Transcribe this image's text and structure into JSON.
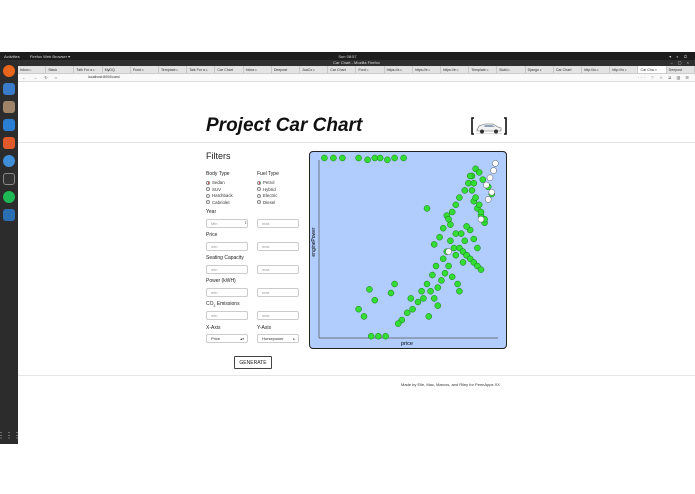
{
  "system": {
    "activities": "Activities",
    "app_menu": "Firefox Web Browser ▾",
    "clock": "Sun 08:57",
    "window_title": "Car Chart - Mozilla Firefox"
  },
  "browser": {
    "tabs": [
      "Inbox ▹",
      "Slack",
      "Talk For a ▹",
      "MyDQ",
      "Front ▹",
      "Template ▹",
      "Talk For a ▹",
      "Car Chart",
      "Inbox ▹",
      "Deepost",
      "JcaCo ▹",
      "Car Chart",
      "Ford ▹",
      "https://a ▹",
      "https://e ▹",
      "https://e ▹",
      "Template ▹",
      "Build ▹",
      "Django ▹",
      "Car Chart",
      "http://lo ▹",
      "http://lo ▹",
      "Car Cha ×",
      "Deepost"
    ],
    "active_tab_index": 22,
    "url": "localhost:8000/cars/",
    "url_menu": "··· ♡ ☆"
  },
  "page": {
    "title": "Project Car Chart",
    "filters_title": "Filters",
    "body_type": {
      "label": "Body Type",
      "options": [
        "Sedan",
        "SUV",
        "Hatchback",
        "Cabriolet"
      ],
      "selected": 0
    },
    "fuel_type": {
      "label": "Fuel Type",
      "options": [
        "Petrol",
        "Hybrid",
        "Electric",
        "Diesel"
      ],
      "selected": 0
    },
    "year": {
      "label": "Year",
      "min_placeholder": "Min",
      "max_placeholder": "max"
    },
    "price": {
      "label": "Price",
      "min_placeholder": "min",
      "max_placeholder": "max"
    },
    "seating": {
      "label": "Seating Capacity",
      "min_placeholder": "min",
      "max_placeholder": "max"
    },
    "power": {
      "label": "Power (kWH)",
      "min_placeholder": "min",
      "max_placeholder": "max"
    },
    "co2": {
      "label_pre": "CO",
      "label_sub": "2",
      "label_post": " Emissions",
      "min_placeholder": "min",
      "max_placeholder": "max"
    },
    "x_axis": {
      "label": "X-Axis",
      "value": "Price"
    },
    "y_axis": {
      "label": "Y-Axis",
      "value": "Horsepower"
    },
    "generate_label": "GENERATE",
    "footer": "Made by Elle, Mac, Marcos, and Riley for PennApps XX"
  },
  "chart_data": {
    "type": "scatter",
    "xlabel": "price",
    "ylabel": "enginePower",
    "colors": {
      "background": "#b0cdfd",
      "point": "#33dd33",
      "point_stroke": "#117711",
      "highlight": "#ffffff"
    },
    "series": [
      {
        "x": [
          0.03,
          0.08,
          0.13,
          0.22,
          0.27,
          0.31,
          0.34,
          0.38,
          0.42,
          0.47,
          0.29,
          0.33,
          0.37,
          0.6,
          0.71,
          0.73,
          0.76,
          0.64,
          0.67,
          0.69,
          0.72,
          0.74,
          0.76,
          0.78,
          0.81,
          0.83,
          0.85,
          0.87,
          0.89,
          0.91,
          0.94,
          0.96,
          0.86,
          0.88,
          0.9,
          0.92,
          0.84,
          0.86,
          0.88,
          0.82,
          0.8,
          0.85,
          0.87,
          0.89,
          0.9,
          0.92,
          0.86,
          0.84,
          0.82,
          0.79,
          0.81,
          0.78,
          0.8,
          0.82,
          0.84,
          0.86,
          0.88,
          0.9,
          0.76,
          0.75,
          0.73,
          0.71,
          0.69,
          0.72,
          0.7,
          0.68,
          0.66,
          0.74,
          0.77,
          0.78,
          0.64,
          0.62,
          0.6,
          0.63,
          0.65,
          0.61,
          0.66,
          0.58,
          0.57,
          0.55,
          0.52,
          0.51,
          0.49,
          0.46,
          0.44,
          0.42,
          0.4,
          0.22,
          0.25,
          0.28,
          0.31
        ],
        "y": [
          1.0,
          1.0,
          1.0,
          1.0,
          0.99,
          1.0,
          1.0,
          0.99,
          1.0,
          1.0,
          0.01,
          0.01,
          0.01,
          0.72,
          0.68,
          0.63,
          0.58,
          0.52,
          0.56,
          0.61,
          0.66,
          0.7,
          0.74,
          0.78,
          0.82,
          0.86,
          0.9,
          0.94,
          0.92,
          0.88,
          0.84,
          0.8,
          0.76,
          0.72,
          0.68,
          0.64,
          0.6,
          0.55,
          0.5,
          0.46,
          0.42,
          0.82,
          0.78,
          0.74,
          0.7,
          0.66,
          0.86,
          0.9,
          0.62,
          0.58,
          0.54,
          0.5,
          0.48,
          0.46,
          0.44,
          0.42,
          0.4,
          0.38,
          0.46,
          0.5,
          0.54,
          0.48,
          0.44,
          0.4,
          0.36,
          0.32,
          0.28,
          0.34,
          0.3,
          0.26,
          0.22,
          0.26,
          0.3,
          0.35,
          0.4,
          0.12,
          0.18,
          0.22,
          0.26,
          0.2,
          0.16,
          0.22,
          0.14,
          0.1,
          0.08,
          0.3,
          0.25,
          0.16,
          0.12,
          0.27,
          0.21
        ]
      },
      {
        "x": [
          0.98,
          0.97,
          0.95,
          0.93,
          0.96,
          0.94,
          0.72,
          0.9
        ],
        "y": [
          0.97,
          0.93,
          0.89,
          0.85,
          0.81,
          0.77,
          0.48,
          0.66
        ],
        "highlight": true
      }
    ]
  }
}
